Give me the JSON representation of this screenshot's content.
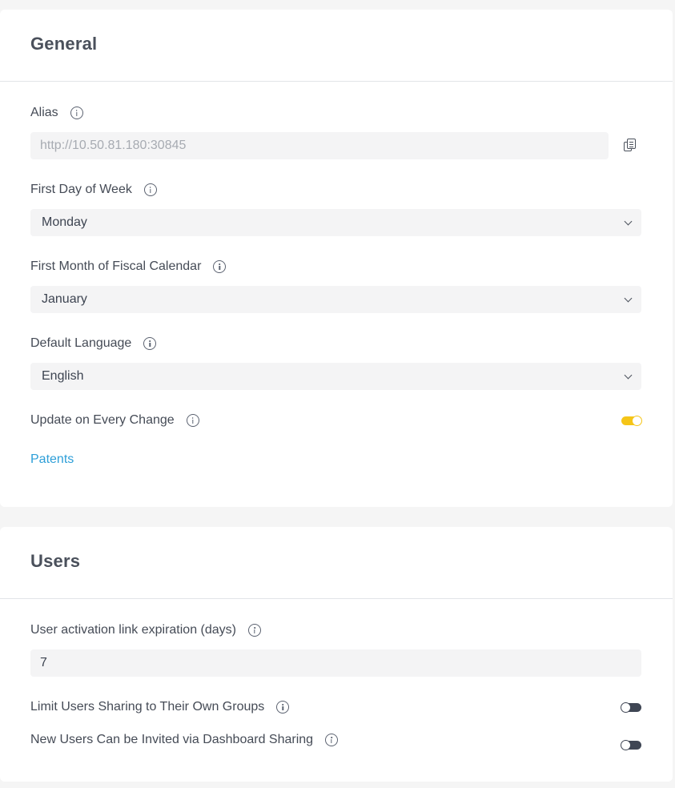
{
  "general": {
    "title": "General",
    "alias": {
      "label": "Alias",
      "value": "http://10.50.81.180:30845",
      "copy_icon": "copy-icon"
    },
    "first_day_of_week": {
      "label": "First Day of Week",
      "value": "Monday"
    },
    "first_month_fiscal": {
      "label": "First Month of Fiscal Calendar",
      "value": "January"
    },
    "default_language": {
      "label": "Default Language",
      "value": "English"
    },
    "update_on_every_change": {
      "label": "Update on Every Change",
      "enabled": true
    },
    "patents_link": "Patents"
  },
  "users": {
    "title": "Users",
    "activation_expiration": {
      "label": "User activation link expiration (days)",
      "value": "7"
    },
    "limit_sharing": {
      "label": "Limit Users Sharing to Their Own Groups",
      "enabled": false
    },
    "invite_via_sharing": {
      "label": "New Users Can be Invited via Dashboard Sharing",
      "enabled": false
    }
  },
  "colors": {
    "accent_toggle_on": "#f5c518",
    "toggle_off": "#3f4654",
    "link": "#2e9fd8"
  }
}
